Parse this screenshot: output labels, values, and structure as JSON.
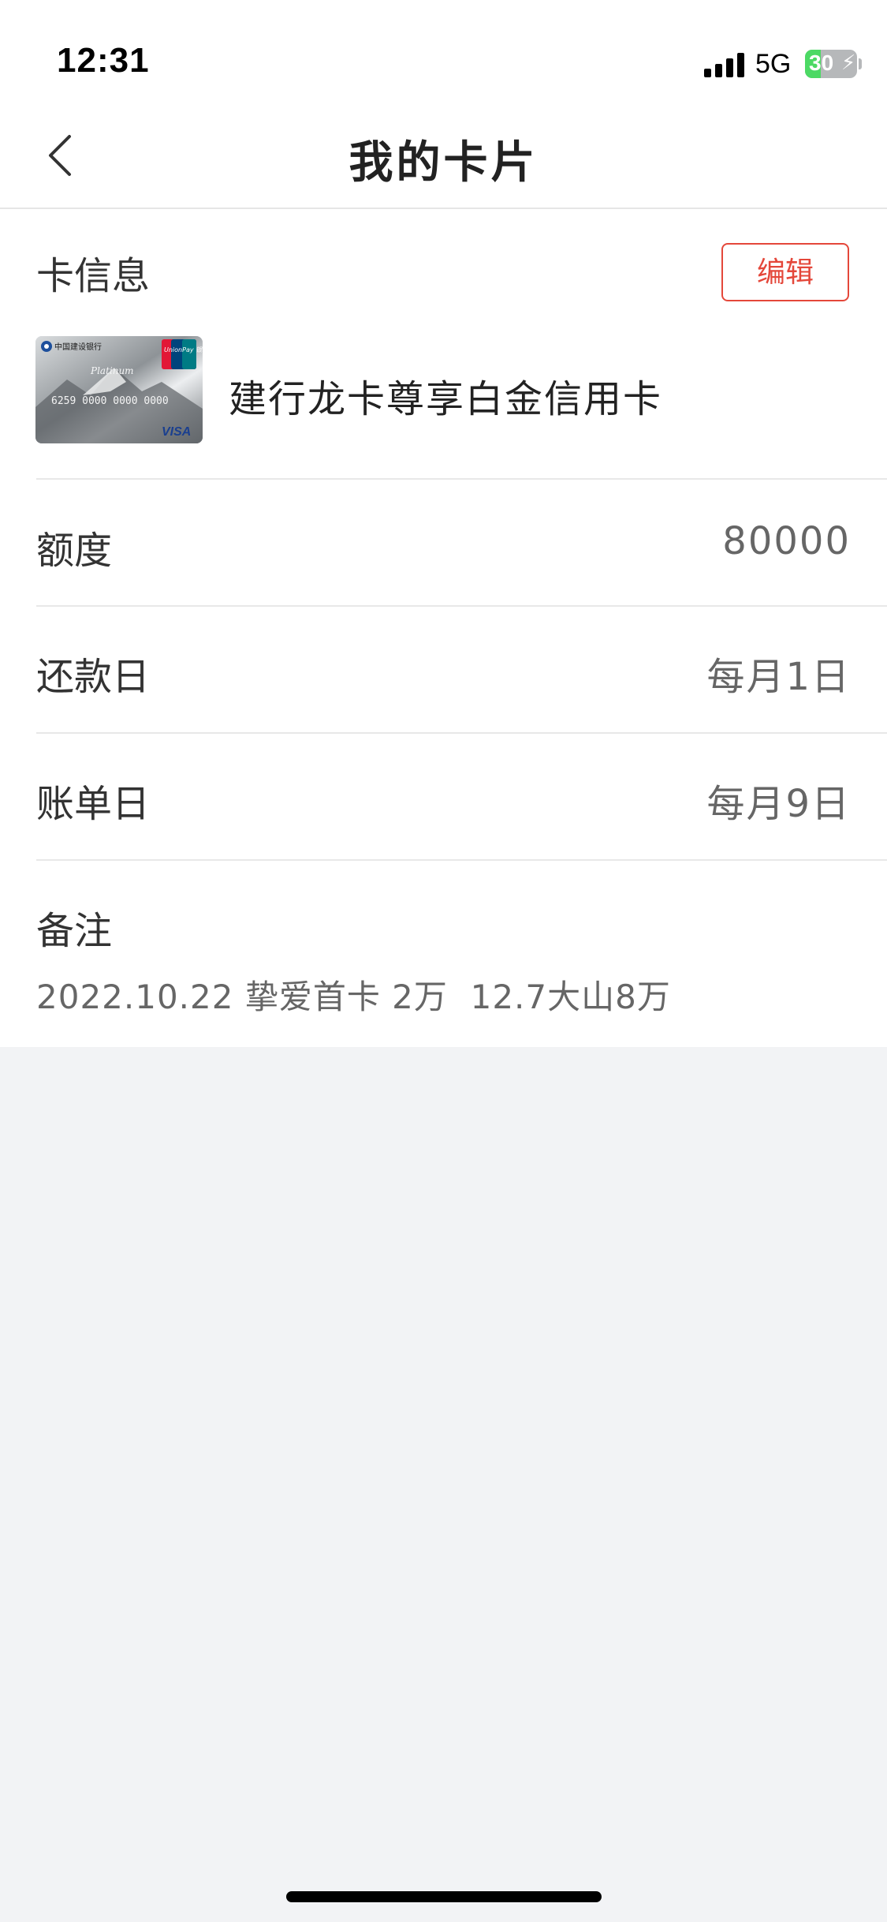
{
  "status_bar": {
    "time": "12:31",
    "network": "5G",
    "battery_level": "30",
    "battery_percent": 30,
    "signal_bars": 4
  },
  "nav": {
    "title": "我的卡片",
    "back_icon": "chevron-left-icon"
  },
  "card_info": {
    "header": "卡信息",
    "edit_label": "编辑",
    "card_name": "建行龙卡尊享白金信用卡",
    "card_image_text": {
      "bank": "中国建设银行",
      "tier": "Platinum",
      "network_logo": "UnionPay 银联",
      "number": "6259 0000 0000 0000",
      "brand": "VISA"
    }
  },
  "rows": [
    {
      "label": "额度",
      "value": "80000"
    },
    {
      "label": "还款日",
      "value": "每月1日"
    },
    {
      "label": "账单日",
      "value": "每月9日"
    }
  ],
  "note": {
    "label": "备注",
    "text": "2022.10.22 挚爱首卡 2万  12.7大山8万"
  },
  "colors": {
    "accent": "#e4473a",
    "background": "#f2f3f5",
    "surface": "#ffffff",
    "battery_green": "#4cd964"
  }
}
